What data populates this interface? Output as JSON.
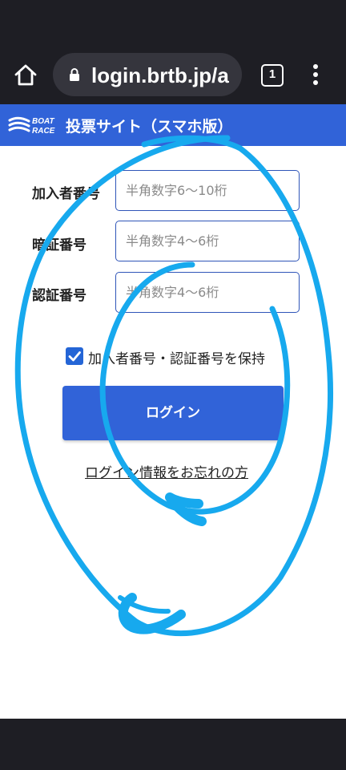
{
  "browser": {
    "url": "login.brtb.jp/a",
    "tab_count": "1"
  },
  "header": {
    "logo_text_top": "BOAT",
    "logo_text_bottom": "RACE",
    "title": "投票サイト（スマホ版）"
  },
  "form": {
    "member_number": {
      "label": "加入者番号",
      "placeholder": "半角数字6〜10桁",
      "value": ""
    },
    "pin": {
      "label": "暗証番号",
      "placeholder": "半角数字4〜6桁",
      "value": ""
    },
    "auth_number": {
      "label": "認証番号",
      "placeholder": "半角数字4〜6桁",
      "value": ""
    },
    "remember": {
      "label": "加入者番号・認証番号を保持",
      "checked": true
    }
  },
  "login_button": "ログイン",
  "forgot_link": "ログイン情報をお忘れの方",
  "colors": {
    "header": "#3163d8",
    "button": "#3163d8",
    "scribble": "#17a9ee",
    "input_border": "#2f55b8",
    "system_bar": "#1e1e24"
  },
  "icons": {
    "home": "home-icon",
    "lock": "lock-icon",
    "tabs": "tab-switcher-icon",
    "menu": "more-vert-icon",
    "check": "check-icon"
  }
}
